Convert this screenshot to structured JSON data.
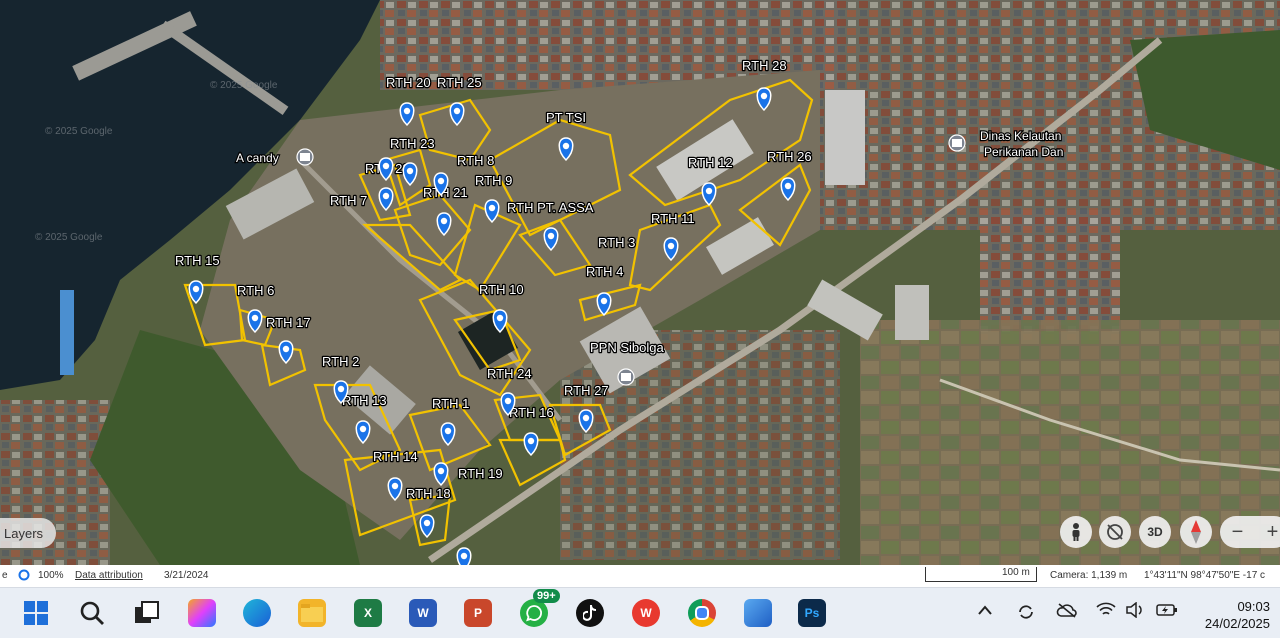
{
  "map": {
    "rth_labels": [
      "RTH 20",
      "RTH 25",
      "RTH 28",
      "RTH 23",
      "PT TSI",
      "RTH 8",
      "RTH 22",
      "RTH 12",
      "RTH 26",
      "RTH 9",
      "RTH 21",
      "RTH 7",
      "RTH PT. ASSA",
      "RTH 11",
      "RTH 3",
      "RTH 15",
      "RTH 4",
      "RTH 6",
      "RTH 10",
      "RTH 17",
      "RTH 2",
      "PPN Sibolga",
      "RTH 24",
      "RTH 27",
      "RTH 13",
      "RTH 1",
      "RTH 16",
      "RTH 14",
      "RTH 19",
      "RTH 18"
    ],
    "poi_labels": {
      "a_candy": "A candy",
      "dinas_line1": "Dinas Kelautan",
      "dinas_line2": "Perikanan Dan"
    },
    "watermarks": [
      "© 2025 Google",
      "© 2025 Google",
      "© 2025 Google"
    ],
    "polygon_color": "#f2c200",
    "pin_color": "#1a73e8"
  },
  "controls": {
    "layers_label": "Layers",
    "view_3d_label": "3D",
    "zoom_out": "−",
    "zoom_in": "+"
  },
  "statusbar": {
    "left_fragment": "e",
    "zoom_pct": "100%",
    "attribution": "Data attribution",
    "imagery_date": "3/21/2024",
    "scale": "100 m",
    "camera": "Camera: 1,139 m",
    "coords": "1°43'11\"N 98°47'50\"E  -17 c"
  },
  "taskbar": {
    "whatsapp_badge": "99+",
    "time": "09:03",
    "date": "24/02/2025"
  }
}
